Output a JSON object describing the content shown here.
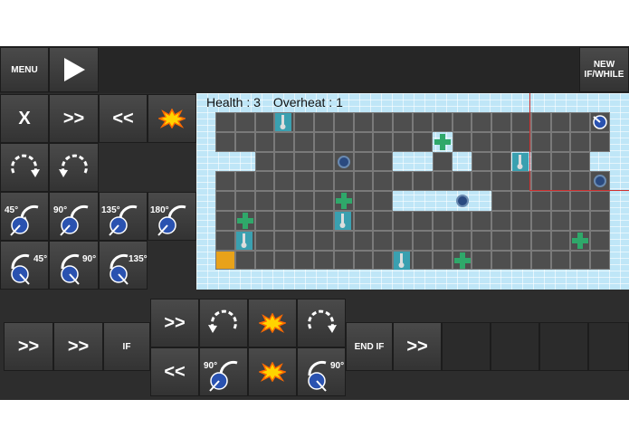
{
  "top": {
    "menu": "MENU",
    "new_ifwhile": "NEW\nIF/WHILE"
  },
  "left_commands": {
    "delete_x": "X",
    "forward": ">>",
    "back": "<<",
    "turret_45": "45°",
    "turret_90": "90°",
    "turret_135": "135°",
    "turret_180": "180°",
    "cw_45": "45°",
    "cw_90": "90°",
    "cw_135": "135°"
  },
  "status": {
    "health": "Health : 3",
    "overheat": "Overheat : 1"
  },
  "program": {
    "item1": ">>",
    "item2": ">>",
    "if_label": "IF",
    "then_forward": ">>",
    "else_back": "<<",
    "else_turret_ccw": "90°",
    "else_turret_cw": "90°",
    "end_if": "END IF",
    "after": ">>"
  },
  "colors": {
    "panel": "#2d2d2d",
    "button": "#3d3d3d",
    "board_bg": "#bfe6f7",
    "floor": "#4e4e4e",
    "start": "#e8a21a"
  }
}
